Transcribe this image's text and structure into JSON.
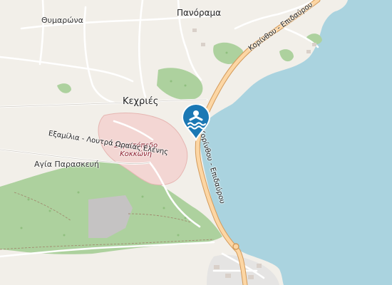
{
  "map": {
    "labels": {
      "panorama": "Πανόραμα",
      "thymarona": "Θυμαρώνα",
      "kechries": "Κεχριές",
      "camp_line1": "Στρατόπεδο",
      "camp_line2": "Κοκκώνη",
      "examilia_road": "Εξαμίλια - Λουτρά Ωραίας Ελένης",
      "agia_paraskevi": "Αγία Παρασκευή",
      "coast_road_north": "Κορίνθου - Επιδαύρου",
      "coast_road_south": "Κορίνθου - Επιδαύρου"
    },
    "marker": {
      "icon": "swimming-beach-icon",
      "color": "#1b78b4"
    },
    "colors": {
      "sea": "#aad3df",
      "land": "#f2efe9",
      "forest": "#add19e",
      "military": "#f3d6d3",
      "quarry": "#c5c3c3",
      "main_road": "#fcd6a4",
      "road_casing": "#d39a5a"
    }
  }
}
